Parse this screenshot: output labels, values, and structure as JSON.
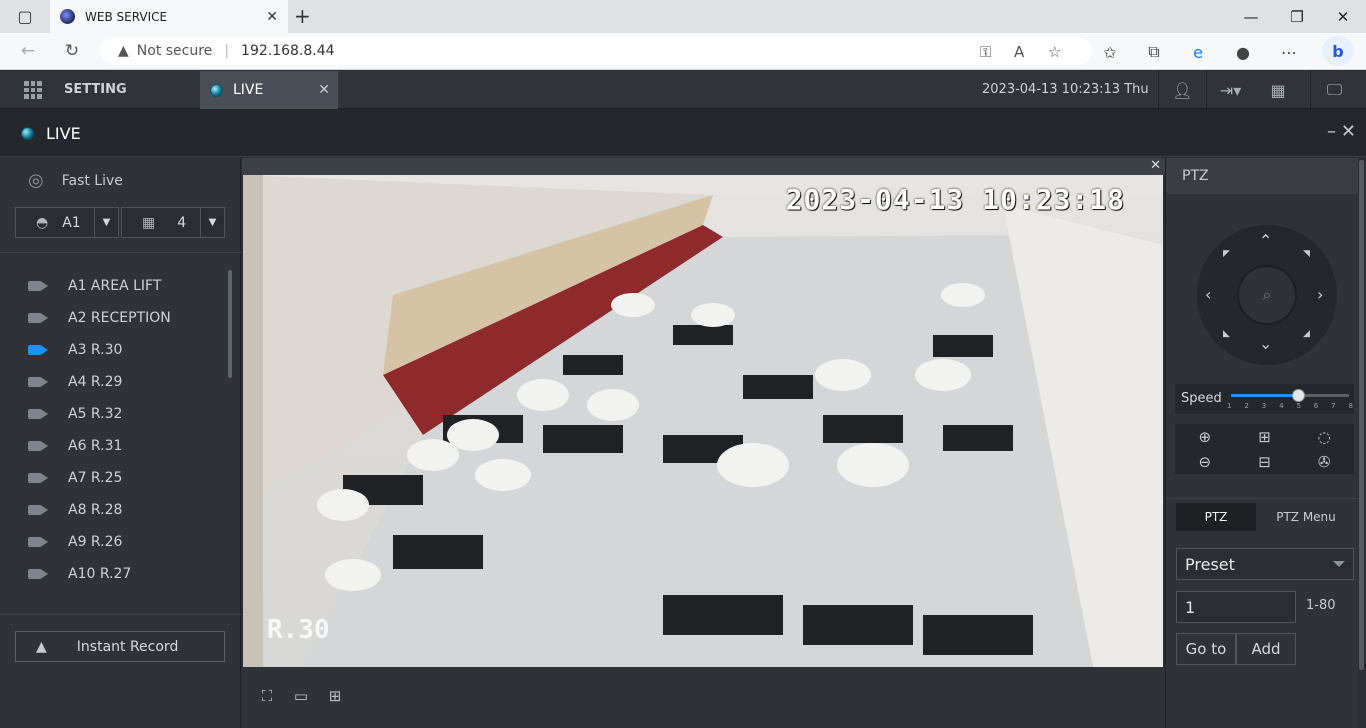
{
  "browser": {
    "tab_title": "WEB SERVICE",
    "not_secure": "Not secure",
    "url": "192.168.8.44"
  },
  "app": {
    "setting_label": "SETTING",
    "live_tab_label": "LIVE",
    "datetime": "2023-04-13 10:23:13 Thu",
    "live_title": "LIVE"
  },
  "left": {
    "fast_live": "Fast Live",
    "area_select": "A1",
    "layout_select": "4",
    "cameras": [
      {
        "label": "A1 AREA LIFT",
        "active": false
      },
      {
        "label": "A2 RECEPTION",
        "active": false
      },
      {
        "label": "A3 R.30",
        "active": true
      },
      {
        "label": "A4 R.29",
        "active": false
      },
      {
        "label": "A5 R.32",
        "active": false
      },
      {
        "label": "A6 R.31",
        "active": false
      },
      {
        "label": "A7 R.25",
        "active": false
      },
      {
        "label": "A8 R.28",
        "active": false
      },
      {
        "label": "A9 R.26",
        "active": false
      },
      {
        "label": "A10 R.27",
        "active": false
      }
    ],
    "instant_record": "Instant Record"
  },
  "video": {
    "timestamp": "2023-04-13 10:23:18",
    "camera_label": "R.30"
  },
  "ptz": {
    "header": "PTZ",
    "speed_label": "Speed",
    "speed_ticks": [
      "1",
      "2",
      "3",
      "4",
      "5",
      "6",
      "7",
      "8"
    ],
    "speed_value": 5,
    "tab_ptz": "PTZ",
    "tab_menu": "PTZ Menu",
    "preset_select": "Preset",
    "preset_value": "1",
    "preset_range": "1-80",
    "goto_btn": "Go to",
    "add_btn": "Add"
  },
  "colors": {
    "accent": "#1e90ff",
    "panel": "#2f3237"
  }
}
